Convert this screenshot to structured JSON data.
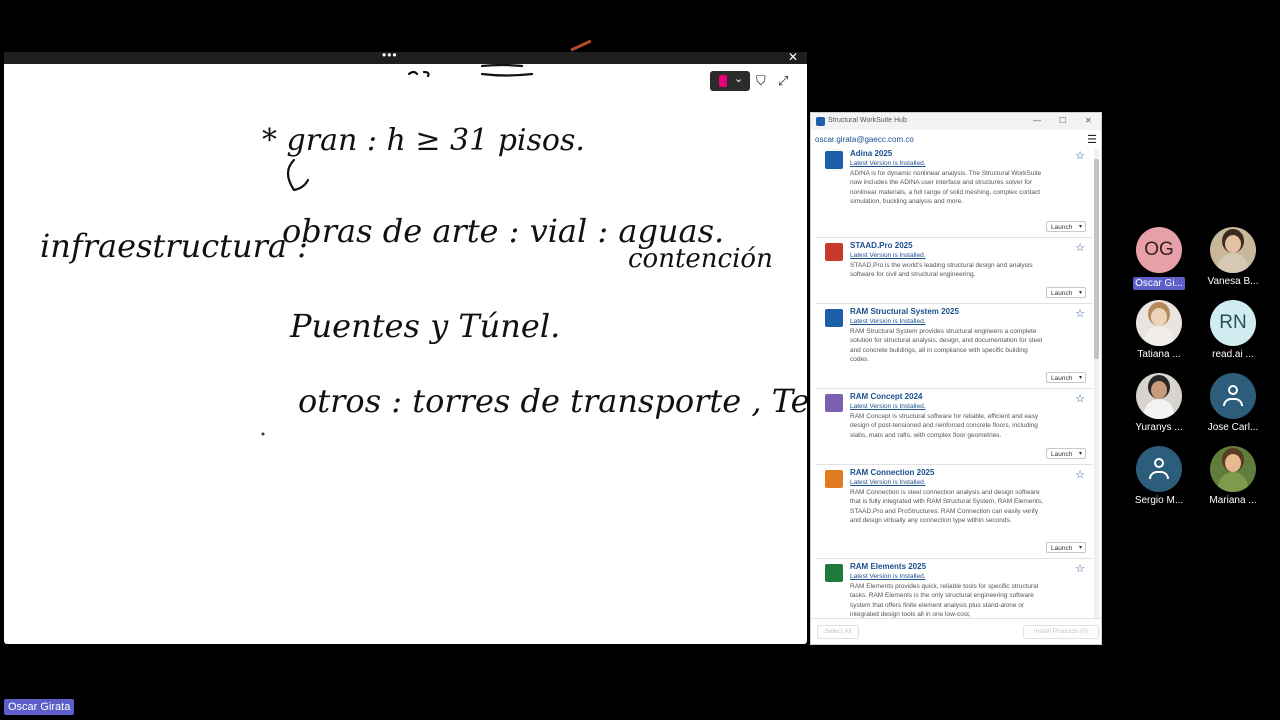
{
  "whiteboard": {
    "handwriting": [
      "* gran :  h ≥ 31 pisos.",
      "infraestructura :",
      "obras de arte : vial : aguas.",
      "contención",
      "Puentes y Túnel.",
      "otros : torres de transporte , Teleco"
    ],
    "pen_color": "#e6007e"
  },
  "hub": {
    "title": "Structural WorkSuite Hub",
    "user_email": "oscar.girata@gaecc.com.co",
    "launch_label": "Launch",
    "products": [
      {
        "name": "Adina 2025",
        "status": "Latest Version is Installed.",
        "desc": "ADINA is for dynamic nonlinear analysis. The Structural WorkSuite now includes the ADINA user interface and structures solver for nonlinear materials, a full range of solid meshing, complex contact simulation, buckling analysis and more.",
        "icon_color": "#1b5fa8"
      },
      {
        "name": "STAAD.Pro 2025",
        "status": "Latest Version is Installed.",
        "desc": "STAAD.Pro is the world’s leading structural design and analysis software for civil and structural engineering.",
        "icon_color": "#c8392b"
      },
      {
        "name": "RAM Structural System 2025",
        "status": "Latest Version is Installed.",
        "desc": "RAM Structural System provides structural engineers a complete solution for structural analysis, design, and documentation for steel and concrete buildings, all in compliance with specific building codes.",
        "icon_color": "#1b5fa8"
      },
      {
        "name": "RAM Concept 2024",
        "status": "Latest Version is Installed.",
        "desc": "RAM Concept is structural software for reliable, efficient and easy design of post-tensioned and reinforced concrete floors, including slabs, mats and rafts, with complex floor geometries.",
        "icon_color": "#7b5fb0"
      },
      {
        "name": "RAM Connection 2025",
        "status": "Latest Version is Installed.",
        "desc": "RAM Connection is steel connection analysis and design software that is fully integrated with RAM Structural System, RAM Elements, STAAD.Pro and ProStructures. RAM Connection can easily verify and design virtually any connection type within seconds.",
        "icon_color": "#e07b1f"
      },
      {
        "name": "RAM Elements 2025",
        "status": "Latest Version is Installed.",
        "desc": "RAM Elements provides quick, reliable tools for specific structural tasks. RAM Elements is the only structural engineering software system that offers finite element analysis plus stand-alone or integrated design tools all in one low-cost,",
        "icon_color": "#1e7b3c"
      }
    ],
    "select_all": "Select All",
    "install_products": "Install Products (0)"
  },
  "participants": [
    {
      "initials": "OG",
      "name": "Oscar Gi...",
      "type": "initials",
      "color": "#e8a0a8",
      "text_color": "#3a1d20"
    },
    {
      "name": "Vanesa B...",
      "type": "photo",
      "bg": "#c9b79a",
      "hair": "#3a2a1e",
      "skin": "#e2c1a4",
      "body": "#d5c8b5"
    },
    {
      "name": "Tatiana ...",
      "type": "photo",
      "bg": "#e9e4df",
      "hair": "#b48a5c",
      "skin": "#efd2bc",
      "body": "#f1eee9"
    },
    {
      "initials": "RN",
      "name": "read.ai ...",
      "type": "initials",
      "color": "#d0ecf1",
      "text_color": "#2b4b5a"
    },
    {
      "name": "Yuranys ...",
      "type": "photo",
      "bg": "#d7d4cf",
      "hair": "#2a2624",
      "skin": "#c89a7c",
      "body": "#f3f3f3"
    },
    {
      "name": "Jose Carl...",
      "type": "generic",
      "color": "#2c5d7a"
    },
    {
      "name": "Sergio M...",
      "type": "generic",
      "color": "#2c5d7a"
    },
    {
      "name": "Mariana ...",
      "type": "photo",
      "bg": "#5f7d3b",
      "hair": "#5a3a22",
      "skin": "#e6b98f",
      "body": "#7f9a4c"
    }
  ],
  "presenter_label": "Oscar Girata"
}
